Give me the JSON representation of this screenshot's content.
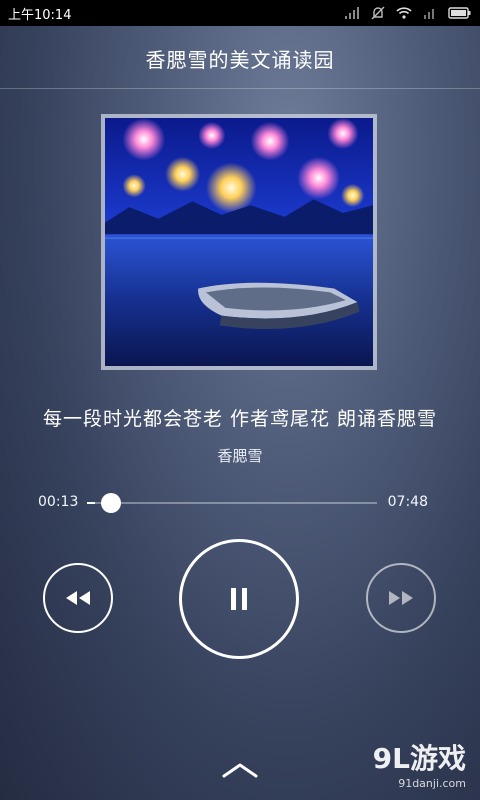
{
  "status_bar": {
    "time": "上午10:14"
  },
  "header": {
    "title": "香腮雪的美文诵读园"
  },
  "track": {
    "title": "每一段时光都会苍老   作者鸢尾花   朗诵香腮雪",
    "artist": "香腮雪"
  },
  "player": {
    "elapsed": "00:13",
    "total": "07:48",
    "progress": 0.028
  },
  "icons": {
    "previous": "rewind-icon",
    "play_pause": "pause-icon",
    "next": "fast-forward-icon",
    "expand": "chevron-up-icon"
  },
  "watermark": {
    "brand": "9L游戏",
    "site": "91danji.com"
  }
}
